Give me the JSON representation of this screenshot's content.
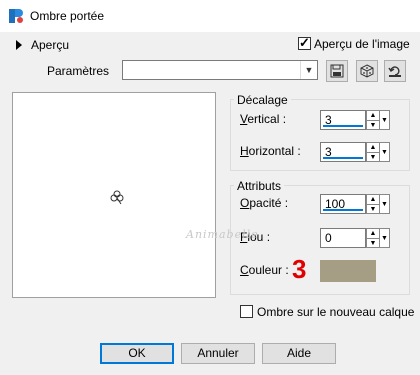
{
  "window": {
    "title": "Ombre portée"
  },
  "preview_section": {
    "label": "Aperçu",
    "image_preview_label": "Aperçu de l'image",
    "image_preview_checked": true
  },
  "presets": {
    "label": "Paramètres",
    "value": ""
  },
  "offset": {
    "title": "Décalage",
    "vertical_label": "Vertical :",
    "vertical_value": "3",
    "horizontal_label": "Horizontal :",
    "horizontal_value": "3"
  },
  "attributes": {
    "title": "Attributs",
    "opacity_label": "Opacité :",
    "opacity_value": "100",
    "blur_label": "Flou :",
    "blur_value": "0",
    "color_label": "Couleur :",
    "color_value": "#a59e85"
  },
  "shadow_new_layer": {
    "label": "Ombre sur le nouveau calque",
    "checked": false
  },
  "buttons": {
    "ok": "OK",
    "cancel": "Annuler",
    "help": "Aide"
  },
  "overlay": {
    "step_number": "3",
    "watermark": "Animabelle"
  }
}
